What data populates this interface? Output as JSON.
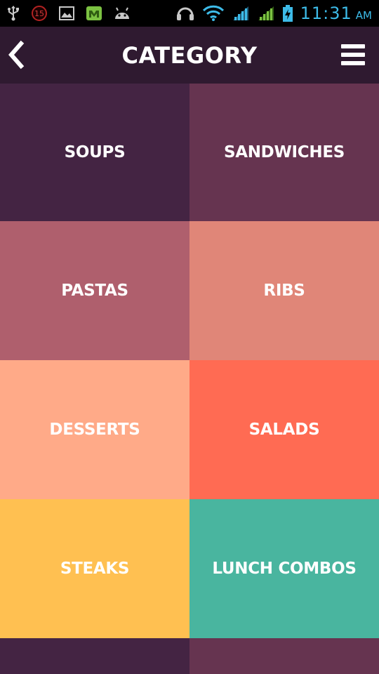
{
  "status_bar": {
    "notification_badge": "15",
    "time": "11:31",
    "ampm": "AM"
  },
  "header": {
    "title": "CATEGORY",
    "back_icon": "chevron-left-icon",
    "menu_icon": "hamburger-menu-icon"
  },
  "categories": [
    {
      "label": "SOUPS",
      "color": "#442443"
    },
    {
      "label": "SANDWICHES",
      "color": "#663450"
    },
    {
      "label": "PASTAS",
      "color": "#af5f6d"
    },
    {
      "label": "RIBS",
      "color": "#e08678"
    },
    {
      "label": "DESSERTS",
      "color": "#ffaa88"
    },
    {
      "label": "SALADS",
      "color": "#ff6b53"
    },
    {
      "label": "STEAKS",
      "color": "#ffc051"
    },
    {
      "label": "LUNCH COMBOS",
      "color": "#49b59f"
    }
  ],
  "colors": {
    "status_bar_bg": "#000000",
    "app_bar_bg": "#2f1a30",
    "time_accent": "#3dbbe8"
  }
}
